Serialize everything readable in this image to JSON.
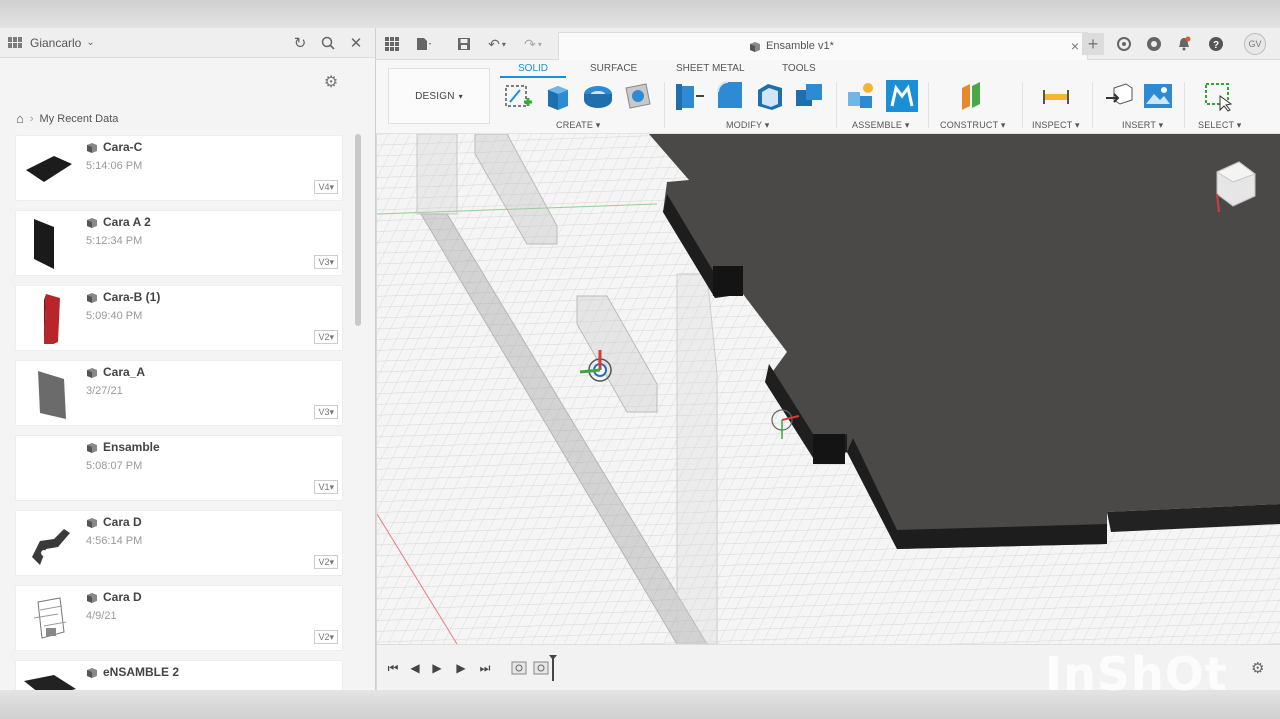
{
  "user": {
    "name": "Giancarlo",
    "initials": "GV"
  },
  "breadcrumb": {
    "location": "My Recent Data"
  },
  "files": [
    {
      "name": "Cara-C",
      "time": "5:14:06 PM",
      "version": "V4",
      "thumb": "flat-plate"
    },
    {
      "name": "Cara A 2",
      "time": "5:12:34 PM",
      "version": "V3",
      "thumb": "dark-panel"
    },
    {
      "name": "Cara-B (1)",
      "time": "5:09:40 PM",
      "version": "V2",
      "thumb": "red-panel"
    },
    {
      "name": "Cara_A",
      "time": "3/27/21",
      "version": "V3",
      "thumb": "grey-panel"
    },
    {
      "name": "Ensamble",
      "time": "5:08:07 PM",
      "version": "V1",
      "thumb": "none"
    },
    {
      "name": "Cara D",
      "time": "4:56:14 PM",
      "version": "V2",
      "thumb": "bracket"
    },
    {
      "name": "Cara D",
      "time": "4/9/21",
      "version": "V2",
      "thumb": "wire-assembly"
    },
    {
      "name": "eNSAMBLE 2",
      "time": "",
      "version": "",
      "thumb": "flat-plate"
    }
  ],
  "document": {
    "title": "Ensamble v1*"
  },
  "toolbar": {
    "workspace": "DESIGN",
    "tabs": [
      "SOLID",
      "SURFACE",
      "SHEET METAL",
      "TOOLS"
    ],
    "active_tab": "SOLID",
    "groups": [
      "CREATE",
      "MODIFY",
      "ASSEMBLE",
      "CONSTRUCT",
      "INSPECT",
      "INSERT",
      "SELECT"
    ]
  },
  "watermark": "InShOt",
  "colors": {
    "accent": "#1a8fd6",
    "body_dark": "#4a4947",
    "grid": "#dcdcdc"
  }
}
